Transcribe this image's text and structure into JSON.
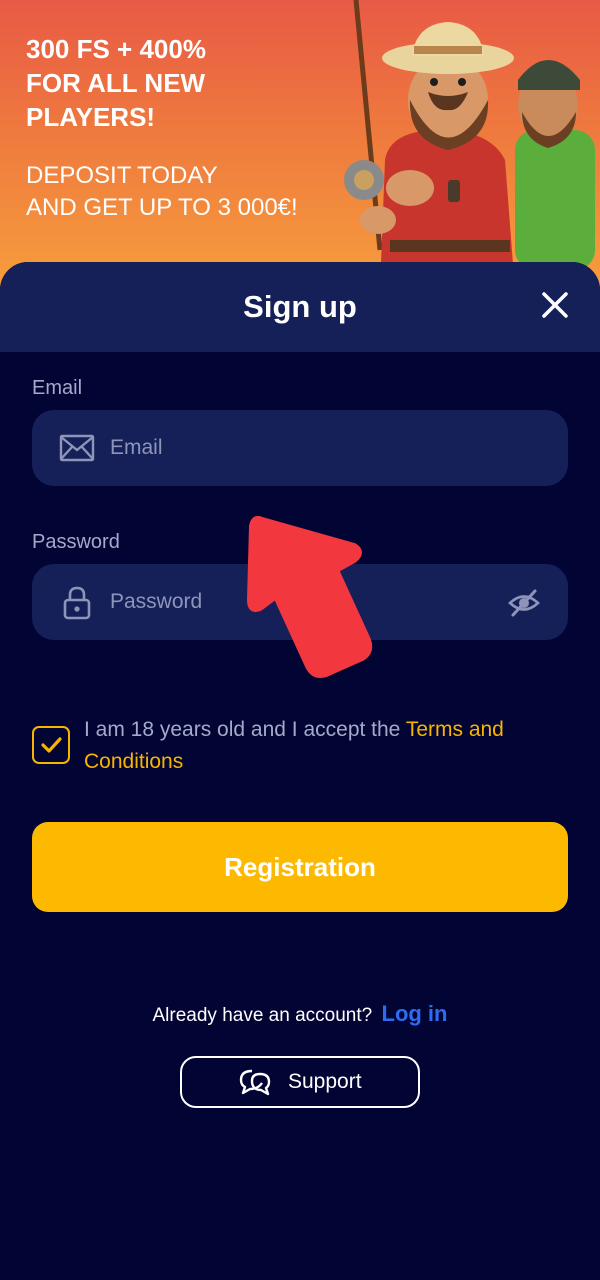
{
  "banner": {
    "title": "300 FS + 400%\nFOR ALL NEW\nPLAYERS!",
    "subtitle": "DEPOSIT TODAY\nAND GET UP TO 3 000€!"
  },
  "modal": {
    "title": "Sign up"
  },
  "email": {
    "label": "Email",
    "placeholder": "Email",
    "value": ""
  },
  "password": {
    "label": "Password",
    "placeholder": "Password",
    "value": ""
  },
  "terms": {
    "checked": true,
    "text": "I am 18 years old and I accept the ",
    "link": "Terms and Conditions"
  },
  "register_button": "Registration",
  "login": {
    "prompt": "Already have an account?",
    "link": "Log in"
  },
  "support_button": "Support",
  "icons": {
    "close": "close-icon",
    "email": "envelope-icon",
    "password": "lock-icon",
    "toggle": "eye-slash-icon",
    "checkbox": "check-icon",
    "support": "chat-bubbles-icon"
  },
  "colors": {
    "background": "#020434",
    "header": "#152059",
    "input": "#152059",
    "accent": "#fdb800",
    "link": "#2d6cf2"
  }
}
